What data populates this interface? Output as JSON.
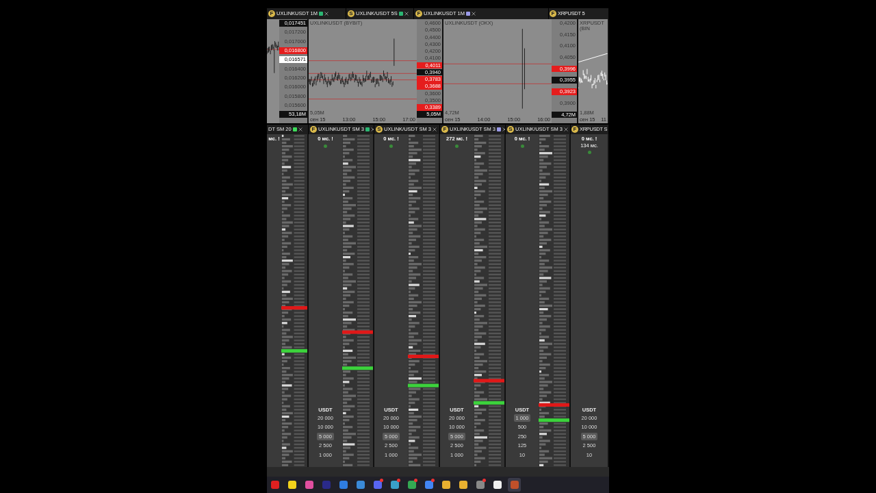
{
  "top_tabs": [
    {
      "badge": "F",
      "label": "UXLINKUSDT 1M",
      "color": "#2bb673"
    },
    {
      "badge": "S",
      "label": "UXLINK/USDT 5S",
      "color": "#2bb673"
    },
    {
      "badge": "F",
      "label": "UXLINKUSDT 1M",
      "color": "#9a9ae8"
    },
    {
      "badge": "F",
      "label": "XRPUSDT 5"
    }
  ],
  "charts": [
    {
      "kind": "partial",
      "axis": [
        {
          "text": "0,017451",
          "color": "#111111"
        },
        {
          "text": "0,017200"
        },
        {
          "text": "0,017000"
        },
        {
          "text": "0,016800",
          "color": "#e51d1d"
        },
        {
          "text": "0,016571",
          "color": "#ffffff"
        },
        {
          "text": "0,016400"
        },
        {
          "text": "0,016200"
        },
        {
          "text": "0,016000"
        },
        {
          "text": "0,015800"
        },
        {
          "text": "0,015600"
        },
        {
          "text": "53,18M",
          "color": "#111111"
        }
      ]
    },
    {
      "kind": "full",
      "title": "UXLINKUSDT (BYBIT)",
      "volume": "5,05M",
      "times": [
        "сен 15",
        "13:00",
        "15:00",
        "17:00"
      ],
      "axis": [
        {
          "text": "0,4600"
        },
        {
          "text": "0,4500"
        },
        {
          "text": "0,4400"
        },
        {
          "text": "0,4300"
        },
        {
          "text": "0,4200"
        },
        {
          "text": "0,4100"
        },
        {
          "text": "0,4011",
          "color": "#e51d1d"
        },
        {
          "text": "0,3940",
          "color": "#111111"
        },
        {
          "text": "0,3783",
          "color": "#e51d1d"
        },
        {
          "text": "0,3688",
          "color": "#e51d1d"
        },
        {
          "text": "0,3600"
        },
        {
          "text": "0,3500"
        },
        {
          "text": "0,3389",
          "color": "#e51d1d"
        },
        {
          "text": "5,05M",
          "color": "#111111"
        }
      ]
    },
    {
      "kind": "full",
      "title": "UXLINKUSDT (OKX)",
      "volume": "4,72M",
      "times": [
        "сен 15",
        "14:00",
        "15:00",
        "16:00"
      ],
      "axis": [
        {
          "text": "0,4200"
        },
        {
          "text": "0,4150"
        },
        {
          "text": "0,4100"
        },
        {
          "text": "0,4050"
        },
        {
          "text": "0,3996",
          "color": "#e51d1d"
        },
        {
          "text": "0,3955",
          "color": "#111111"
        },
        {
          "text": "0,3923",
          "color": "#e51d1d"
        },
        {
          "text": "0,3900"
        },
        {
          "text": "4,72M",
          "color": "#111111"
        }
      ]
    },
    {
      "kind": "plot",
      "title": "XRPUSDT (BIN",
      "volume": "1,88M",
      "times": [
        "сен 15",
        "11"
      ]
    }
  ],
  "dom_tabs": [
    {
      "label": "DT SM 20",
      "color": "#3ddc5a"
    },
    {
      "badge": "F",
      "label": "UXLINKUSDT SM 3",
      "color": "#2bb673"
    },
    {
      "badge": "S",
      "label": "UXLINK/USDT SM 3"
    },
    {
      "badge": "F",
      "label": "UXLINKUSDT SM 3",
      "color": "#9a9ae8"
    },
    {
      "badge": "S",
      "label": "UXLINK/USDT SM 3"
    },
    {
      "badge": "F",
      "label": "XRPUSDT S"
    }
  ],
  "dom_panels": [
    {
      "kind": "partial",
      "latency": "мс. !"
    },
    {
      "kind": "full",
      "latency": "0 мс. !",
      "scale": [
        {
          "text": "20 000",
          "selected": false
        },
        {
          "text": "10 000",
          "selected": false
        },
        {
          "text": "5 000",
          "selected": true
        },
        {
          "text": "2 500",
          "selected": false
        },
        {
          "text": "1 000",
          "selected": false
        }
      ],
      "unit": "USDT"
    },
    {
      "kind": "full",
      "latency": "0 мс. !",
      "scale": [
        {
          "text": "20 000",
          "selected": false
        },
        {
          "text": "10 000",
          "selected": false
        },
        {
          "text": "5 000",
          "selected": true
        },
        {
          "text": "2 500",
          "selected": false
        },
        {
          "text": "1 000",
          "selected": false
        }
      ],
      "unit": "USDT"
    },
    {
      "kind": "full",
      "latency": "272 мс. !",
      "scale": [
        {
          "text": "20 000",
          "selected": false
        },
        {
          "text": "10 000",
          "selected": false
        },
        {
          "text": "5 000",
          "selected": true
        },
        {
          "text": "2 500",
          "selected": false
        },
        {
          "text": "1 000",
          "selected": false
        }
      ],
      "unit": "USDT"
    },
    {
      "kind": "full",
      "latency": "0 мс. !",
      "scale": [
        {
          "text": "1 000",
          "selected": true
        },
        {
          "text": "500",
          "selected": false
        },
        {
          "text": "250",
          "selected": false
        },
        {
          "text": "125",
          "selected": false
        },
        {
          "text": "10",
          "selected": false
        }
      ],
      "unit": "USDT"
    },
    {
      "kind": "edge",
      "latency": "0 мс. !",
      "latency_2": "134 мс.",
      "scale": [
        {
          "text": "20 000",
          "selected": false
        },
        {
          "text": "10 000",
          "selected": false
        },
        {
          "text": "5 000",
          "selected": true
        },
        {
          "text": "2 500",
          "selected": false
        },
        {
          "text": "10",
          "selected": false
        }
      ],
      "unit": "USDT"
    }
  ],
  "taskbar": [
    {
      "color": "#e02020",
      "selected": false,
      "notification": false
    },
    {
      "color": "#f2d21b",
      "selected": false,
      "notification": false
    },
    {
      "color": "#e04fa0",
      "selected": false,
      "notification": false
    },
    {
      "color": "#2a2a8a",
      "selected": false,
      "notification": false
    },
    {
      "color": "#2f7de0",
      "selected": false,
      "notification": false
    },
    {
      "color": "#3a8ad8",
      "selected": false,
      "notification": false
    },
    {
      "color": "#5865f2",
      "selected": false,
      "notification": true
    },
    {
      "color": "#3aa0c8",
      "selected": false,
      "notification": true
    },
    {
      "color": "#34a853",
      "selected": false,
      "notification": true
    },
    {
      "color": "#4285f4",
      "selected": false,
      "notification": true
    },
    {
      "color": "#e8b030",
      "selected": false,
      "notification": false
    },
    {
      "color": "#e8b030",
      "selected": false,
      "notification": false
    },
    {
      "color": "#888888",
      "selected": false,
      "notification": true
    },
    {
      "color": "#f0f0f0",
      "selected": false,
      "notification": false
    },
    {
      "color": "#c0502a",
      "selected": true,
      "notification": false
    }
  ]
}
